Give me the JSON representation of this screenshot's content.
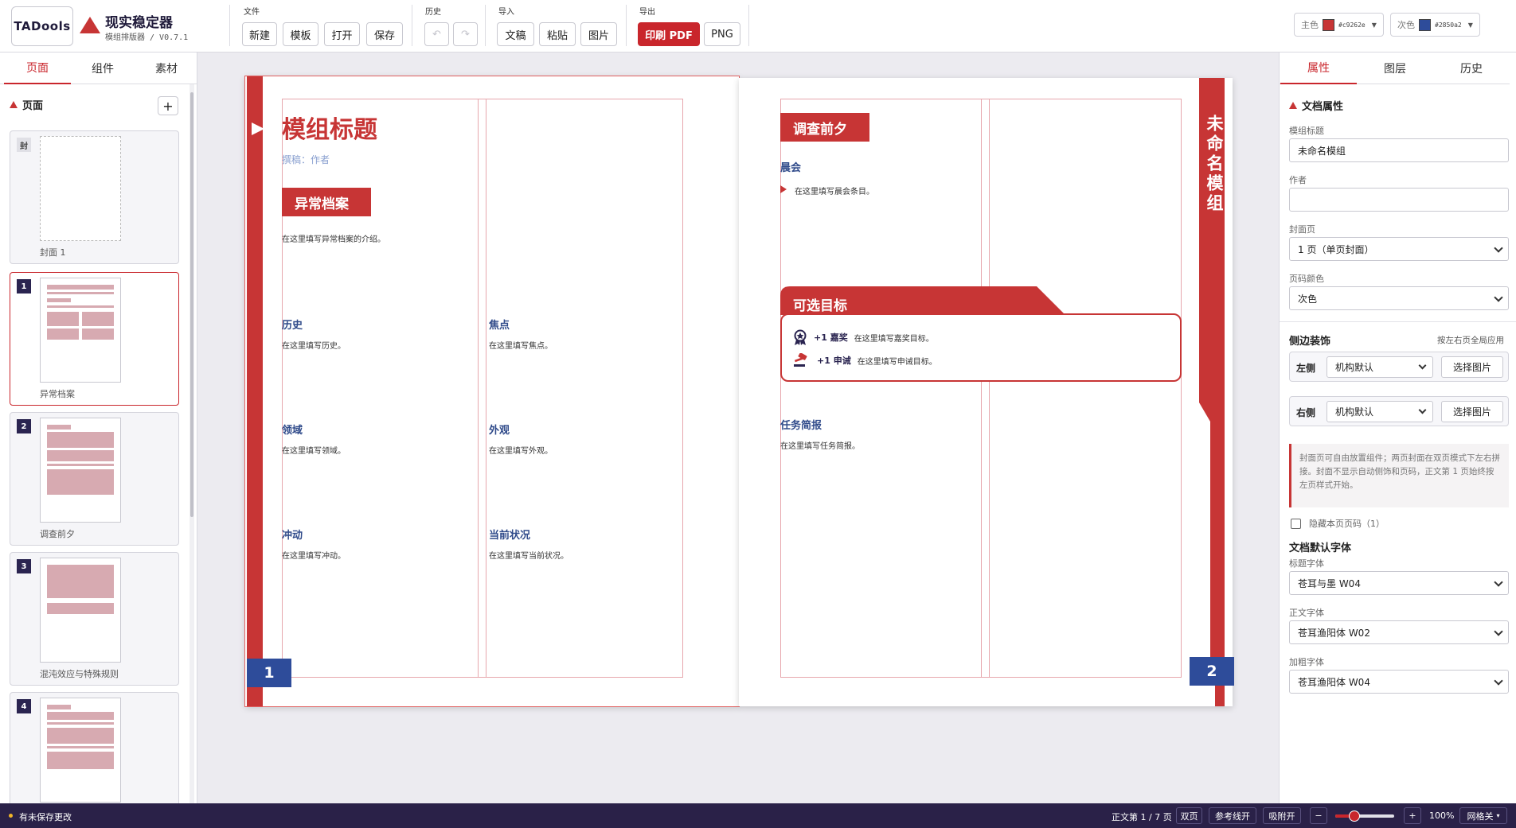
{
  "app": {
    "logo_text": "TADools",
    "title": "现实稳定器",
    "subtitle": "模组排版器 / V0.7.1"
  },
  "toolbar": {
    "groups": {
      "file": "文件",
      "history": "历史",
      "import": "导入",
      "export": "导出"
    },
    "file_buttons": [
      "新建",
      "模板",
      "打开",
      "保存"
    ],
    "undo_icon": "↶",
    "redo_icon": "↷",
    "import_buttons": [
      "文稿",
      "粘贴",
      "图片"
    ],
    "export_primary": "印刷 PDF",
    "export_png": "PNG",
    "primary_color": {
      "label": "主色",
      "hex": "#c9262e",
      "swatch": "#c73535"
    },
    "secondary_color": {
      "label": "次色",
      "hex": "#2850a2",
      "swatch": "#2e4c9a"
    }
  },
  "left_panel": {
    "tabs": [
      "页面",
      "组件",
      "素材"
    ],
    "section_title": "页面",
    "add_label": "+",
    "pages": [
      {
        "badge": "封",
        "label": "封面 1"
      },
      {
        "badge": "1",
        "label": "异常档案"
      },
      {
        "badge": "2",
        "label": "调查前夕"
      },
      {
        "badge": "3",
        "label": "混沌效应与特殊规则"
      },
      {
        "badge": "4",
        "label": ""
      }
    ]
  },
  "spread": {
    "left": {
      "title": "模组标题",
      "byline": "撰稿：作者",
      "banner": "异常档案",
      "intro": "在这里填写异常档案的介绍。",
      "sections": [
        {
          "heading": "历史",
          "body": "在这里填写历史。"
        },
        {
          "heading": "焦点",
          "body": "在这里填写焦点。"
        },
        {
          "heading": "领域",
          "body": "在这里填写领域。"
        },
        {
          "heading": "外观",
          "body": "在这里填写外观。"
        },
        {
          "heading": "冲动",
          "body": "在这里填写冲动。"
        },
        {
          "heading": "当前状况",
          "body": "在这里填写当前状况。"
        }
      ],
      "page_number": "1"
    },
    "right": {
      "banner": "调查前夕",
      "morning_heading": "晨会",
      "morning_body": "在这里填写晨会条目。",
      "optional_banner": "可选目标",
      "rewards": [
        {
          "tag": "+1 嘉奖",
          "body": "在这里填写嘉奖目标。"
        },
        {
          "tag": "+1 申诫",
          "body": "在这里填写申诫目标。"
        }
      ],
      "brief_heading": "任务简报",
      "brief_body": "在这里填写任务简报。",
      "spine_title": "未命名模组",
      "page_number": "2"
    }
  },
  "right_panel": {
    "tabs": [
      "属性",
      "图层",
      "历史"
    ],
    "section_title": "文档属性",
    "fields": {
      "title_label": "模组标题",
      "title_value": "未命名模组",
      "author_label": "作者",
      "author_value": "",
      "cover_label": "封面页",
      "cover_value": "1 页（单页封面）",
      "page_color_label": "页码颜色",
      "page_color_value": "次色"
    },
    "side_deco": {
      "title": "侧边装饰",
      "hint": "按左右页全局应用",
      "left_label": "左侧",
      "right_label": "右侧",
      "select_value": "机构默认",
      "pick_label": "选择图片"
    },
    "note": "封面页可自由放置组件；两页封面在双页模式下左右拼接。封面不显示自动侧饰和页码，正文第 1 页始终按左页样式开始。",
    "hide_page_label": "隐藏本页页码（1）",
    "fonts": {
      "title": "文档默认字体",
      "heading_label": "标题字体",
      "heading_value": "苍耳与墨 W04",
      "body_label": "正文字体",
      "body_value": "苍耳渔阳体 W02",
      "bold_label": "加粗字体",
      "bold_value": "苍耳渔阳体 W04"
    }
  },
  "statusbar": {
    "unsaved": "有未保存更改",
    "page_info": "正文第 1 / 7 页",
    "buttons": [
      "双页",
      "参考线开",
      "吸附开"
    ],
    "zoom_minus": "−",
    "zoom_plus": "+",
    "zoom_value": "100%",
    "zoom_fraction": 0.32,
    "grid": "网格关",
    "grid_caret": "▾"
  }
}
